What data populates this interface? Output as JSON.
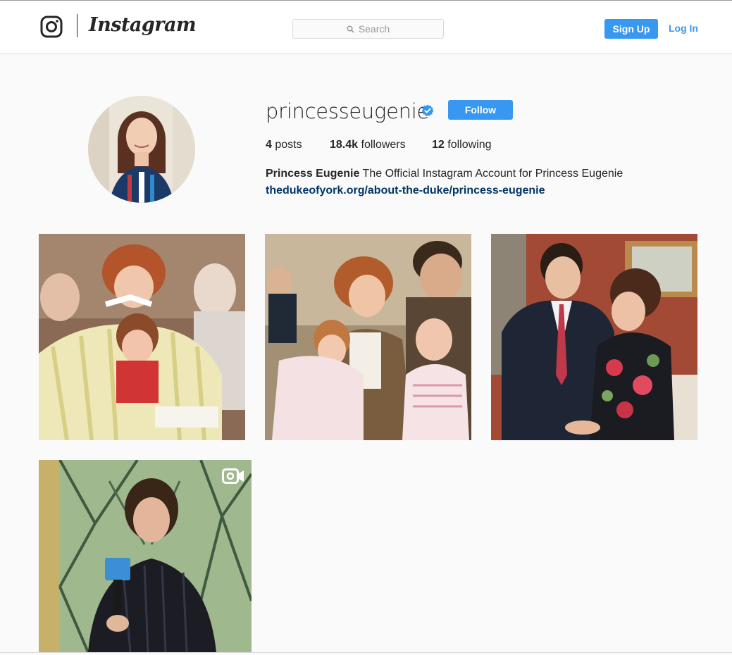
{
  "header": {
    "wordmark": "Instagram",
    "search_placeholder": "Search",
    "signup_label": "Sign Up",
    "login_label": "Log In",
    "brand_blue": "#3897f0"
  },
  "profile": {
    "username": "princesseugenie",
    "verified": true,
    "follow_label": "Follow",
    "stats": [
      {
        "count": "4",
        "label": "posts"
      },
      {
        "count": "18.4k",
        "label": "followers"
      },
      {
        "count": "12",
        "label": "following"
      }
    ],
    "full_name": "Princess Eugenie",
    "bio": "The Official Instagram Account for Princess Eugenie",
    "website": "thedukeofyork.org/about-the-duke/princess-eugenie"
  },
  "posts": [
    {
      "kind": "photo"
    },
    {
      "kind": "photo"
    },
    {
      "kind": "photo"
    },
    {
      "kind": "video",
      "icon": "video-camera-icon"
    }
  ]
}
